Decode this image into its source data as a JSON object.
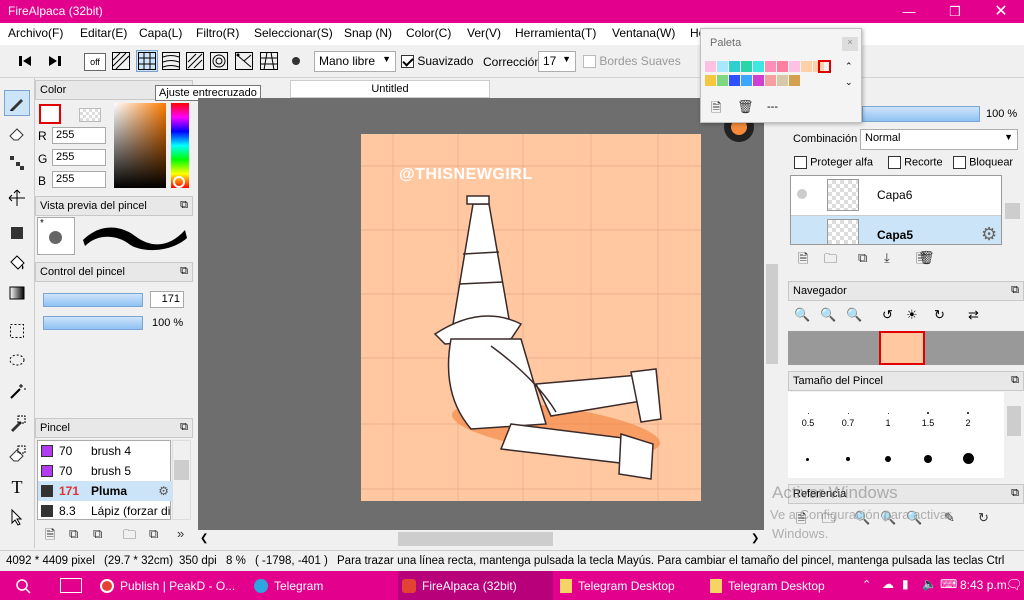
{
  "titlebar": {
    "title": "FireAlpaca (32bit)"
  },
  "menu": [
    "Archivo(F)",
    "Editar(E)",
    "Capa(L)",
    "Filtro(R)",
    "Seleccionar(S)",
    "Snap (N)",
    "Color(C)",
    "Ver(V)",
    "Herramienta(T)",
    "Ventana(W)",
    "He"
  ],
  "toolbar": {
    "off_label": "off",
    "tooltip": "Ajuste entrecruzado",
    "mode": "Mano libre",
    "smooth_label": "Suavizado",
    "correction_label": "Corrección",
    "correction_value": "17",
    "soft_edges_label": "Bordes Suaves"
  },
  "color_panel": {
    "title": "Color",
    "r_label": "R",
    "g_label": "G",
    "b_label": "B",
    "r": "255",
    "g": "255",
    "b": "255"
  },
  "brush_preview": {
    "title": "Vista previa del pincel",
    "star": "*"
  },
  "brush_control": {
    "title": "Control del pincel",
    "size": "171",
    "opacity": "100 %"
  },
  "brush_panel": {
    "title": "Pincel",
    "items": [
      {
        "size": "70",
        "name": "brush 4",
        "color": "#b23cf0"
      },
      {
        "size": "70",
        "name": "brush 5",
        "color": "#b23cf0"
      },
      {
        "size": "171",
        "name": "Pluma",
        "color": "#333333"
      },
      {
        "size": "8.3",
        "name": "Lápiz (forzar di",
        "color": "#333333"
      }
    ]
  },
  "tab": {
    "title": "Untitled"
  },
  "canvas": {
    "watermark": "@THISNEWGIRL"
  },
  "palette": {
    "title": "Paleta",
    "colors": [
      "#ffc1e3",
      "#a8e8ff",
      "#2ecfcf",
      "#28d6a8",
      "#3ee8e0",
      "#ff8fb8",
      "#ff7f9e",
      "#ffc1e3",
      "#ffd1a8",
      "#ffd1a8",
      "#3c4bff",
      "#00c0c0",
      "#ff40ff",
      "#ffb0a0",
      "#c4b894",
      "#ff6060"
    ],
    "colors_row2": [
      "#f5c842",
      "#7fd87f",
      "#2e50ff",
      "#3aa6ff",
      "#d040d0",
      "#f4a0a0",
      "#d8c8a8",
      "#d4a050"
    ],
    "dashes": "---"
  },
  "layers_panel": {
    "opacity": "100 %",
    "blend_label": "Combinación",
    "blend_value": "Normal",
    "protect_alpha": "Proteger alfa",
    "clip": "Recorte",
    "lock": "Bloquear",
    "layers": [
      {
        "name": "Capa6"
      },
      {
        "name": "Capa5"
      }
    ]
  },
  "navigator": {
    "title": "Navegador"
  },
  "brush_size": {
    "title": "Tamaño del Pincel",
    "sizes": [
      "0.5",
      "0.7",
      "1",
      "1.5",
      "2"
    ]
  },
  "reference": {
    "title": "Referencia"
  },
  "activation": {
    "line1": "Activar Windows",
    "line2": "Ve a Configuración para activar",
    "line3": "Windows."
  },
  "status": {
    "dims": "4092 * 4409 pixel",
    "cm": "(29.7 * 32cm)",
    "dpi": "350 dpi",
    "zoom": "8 %",
    "coords": "( -1798, -401 )",
    "hint": "Para trazar una línea recta, mantenga pulsada la tecla Mayús. Para cambiar el tamaño del pincel, mantenga pulsada las teclas Ctrl"
  },
  "taskbar": {
    "items": [
      {
        "label": "Publish | PeakD - O..."
      },
      {
        "label": "Telegram"
      },
      {
        "label": "FireAlpaca (32bit)"
      },
      {
        "label": "Telegram Desktop"
      },
      {
        "label": "Telegram Desktop"
      }
    ],
    "time": "8:43 p.m."
  }
}
